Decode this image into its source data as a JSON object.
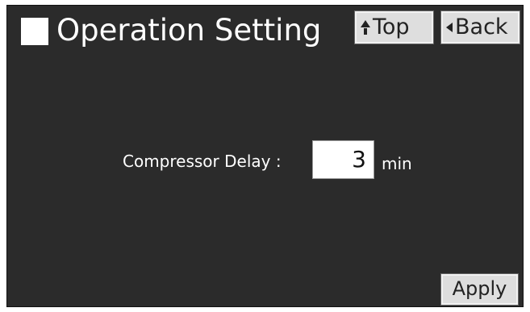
{
  "header": {
    "title": "Operation Setting",
    "top_label": "Top",
    "back_label": "Back"
  },
  "form": {
    "field_label": "Compressor Delay :",
    "value": "3",
    "unit": "min"
  },
  "footer": {
    "apply_label": "Apply"
  },
  "colors": {
    "screen_background": "#2b2b2b",
    "button_background": "#dedede",
    "text_on_dark": "#ffffff"
  },
  "icons": {
    "title_marker": "square-icon",
    "top": "arrow-up-icon",
    "back": "arrow-left-icon"
  }
}
